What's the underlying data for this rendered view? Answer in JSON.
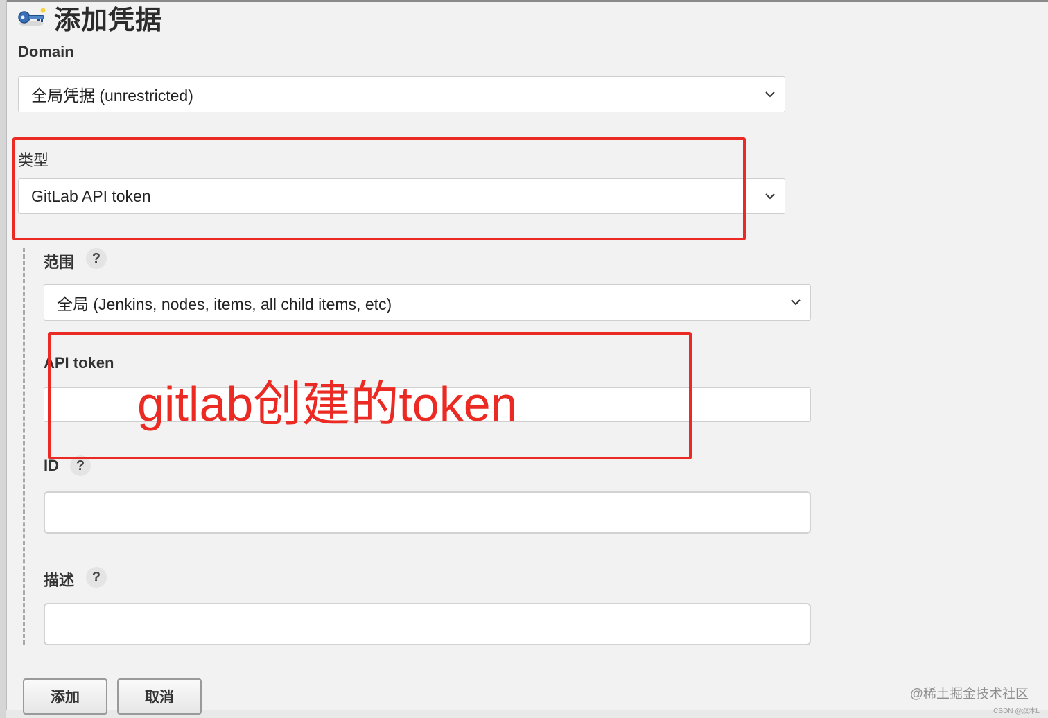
{
  "page": {
    "title": "添加凭据",
    "title_icon": "key-icon"
  },
  "form": {
    "domain": {
      "label": "Domain",
      "selected": "全局凭据 (unrestricted)"
    },
    "kind": {
      "label": "类型",
      "selected": "GitLab API token"
    },
    "scope": {
      "label": "范围",
      "help": "?",
      "selected": "全局 (Jenkins, nodes, items, all child items, etc)"
    },
    "api_token": {
      "label": "API token",
      "value": ""
    },
    "id": {
      "label": "ID",
      "help": "?",
      "value": ""
    },
    "description": {
      "label": "描述",
      "help": "?",
      "value": ""
    }
  },
  "buttons": {
    "add": "添加",
    "cancel": "取消"
  },
  "annotation": {
    "text": "gitlab创建的token",
    "color": "#ea2a23"
  },
  "watermark": {
    "main": "@稀土掘金技术社区",
    "small": "CSDN @双木L"
  }
}
